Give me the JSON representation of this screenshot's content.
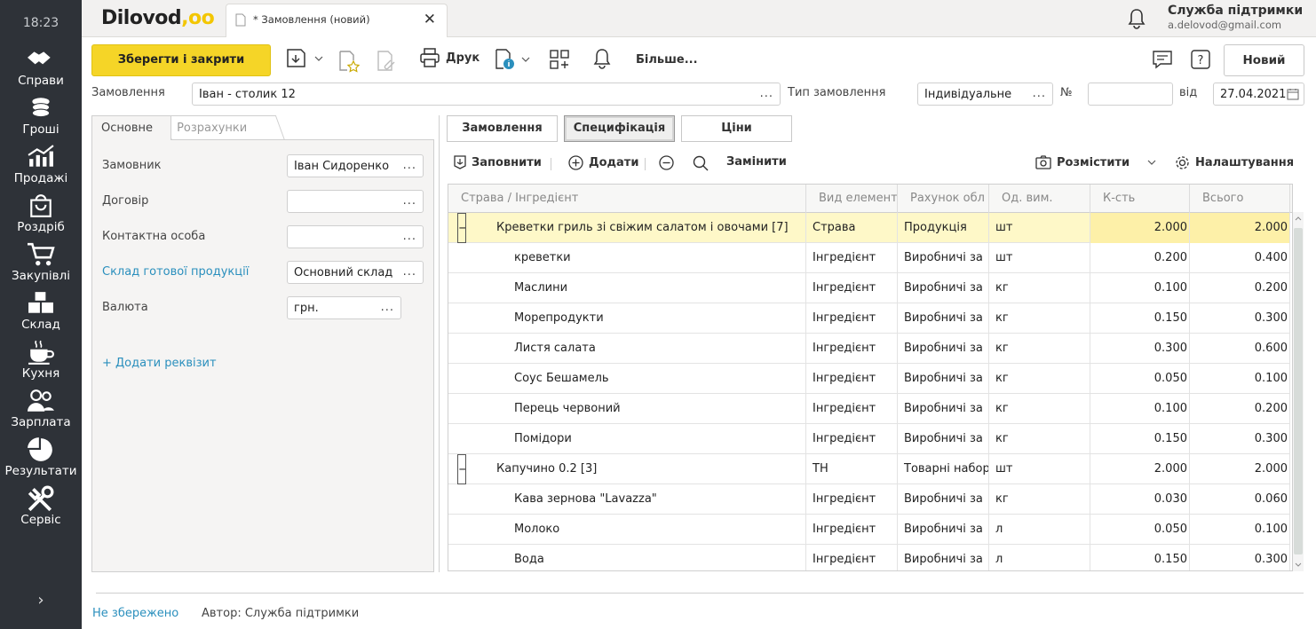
{
  "clock": "18:23",
  "sidebar": [
    {
      "label": "Справи",
      "icon": "handshake-icon"
    },
    {
      "label": "Гроші",
      "icon": "coins-icon"
    },
    {
      "label": "Продажі",
      "icon": "chart-icon"
    },
    {
      "label": "Роздріб",
      "icon": "shopping-bag-icon"
    },
    {
      "label": "Закупівлі",
      "icon": "cart-icon"
    },
    {
      "label": "Склад",
      "icon": "boxes-icon"
    },
    {
      "label": "Кухня",
      "icon": "cup-icon"
    },
    {
      "label": "Зарплата",
      "icon": "people-icon"
    },
    {
      "label": "Результати",
      "icon": "pie-icon"
    },
    {
      "label": "Сервіс",
      "icon": "tools-icon"
    }
  ],
  "sidebar_toggle": "›",
  "app": {
    "logo": "Dilovod",
    "logo_dots": ",oo",
    "tab_title": "* Замовлення (новий)",
    "tab_close": "✕"
  },
  "user": {
    "name": "Служба підтримки",
    "email": "a.delovod@gmail.com"
  },
  "toolbar": {
    "save_close": "Зберегти і закрити",
    "print": "Друк",
    "more": "Більше...",
    "new": "Новий"
  },
  "header": {
    "order_label": "Замовлення",
    "order_value": "Іван - столик 12",
    "type_label": "Тип замовлення",
    "type_value": "Індивідуальне",
    "num_label": "№",
    "num_value": "",
    "from_label": "від",
    "date_value": "27.04.2021",
    "dots": "..."
  },
  "left_tabs": [
    "Основне",
    "Розрахунки"
  ],
  "left_fields": [
    {
      "label": "Замовник",
      "value": "Іван Сидоренко"
    },
    {
      "label": "Договір",
      "value": ""
    },
    {
      "label": "Контактна особа",
      "value": ""
    },
    {
      "label": "Склад готової продукції",
      "value": "Основний склад"
    },
    {
      "label": "Валюта",
      "value": "грн."
    }
  ],
  "add_requisite": "+ Додати реквізит",
  "right_tabs": [
    "Замовлення",
    "Специфікація",
    "Ціни"
  ],
  "grid_toolbar": {
    "fill": "Заповнити",
    "add": "Додати",
    "replace": "Замінити",
    "place": "Розмістити",
    "settings": "Налаштування"
  },
  "columns": [
    "Страва / Інгредієнт",
    "Вид елемент",
    "Рахунок обл",
    "Од. вим.",
    "К-сть",
    "Всього"
  ],
  "rows": [
    {
      "name": "Креветки гриль зі свіжим салатом і овочами [7]",
      "kind": "Страва",
      "account": "Продукція",
      "unit": "шт",
      "qty": "2.000",
      "total": "2.000",
      "level": 0,
      "toggle": "−",
      "highlight": true
    },
    {
      "name": "креветки",
      "kind": "Інгредієнт",
      "account": "Виробничі за",
      "unit": "шт",
      "qty": "0.200",
      "total": "0.400",
      "level": 1
    },
    {
      "name": "Маслини",
      "kind": "Інгредієнт",
      "account": "Виробничі за",
      "unit": "кг",
      "qty": "0.100",
      "total": "0.200",
      "level": 1
    },
    {
      "name": "Морепродукти",
      "kind": "Інгредієнт",
      "account": "Виробничі за",
      "unit": "кг",
      "qty": "0.150",
      "total": "0.300",
      "level": 1
    },
    {
      "name": "Листя салата",
      "kind": "Інгредієнт",
      "account": "Виробничі за",
      "unit": "кг",
      "qty": "0.300",
      "total": "0.600",
      "level": 1
    },
    {
      "name": "Соус Бешамель",
      "kind": "Інгредієнт",
      "account": "Виробничі за",
      "unit": "кг",
      "qty": "0.050",
      "total": "0.100",
      "level": 1
    },
    {
      "name": "Перець червоний",
      "kind": "Інгредієнт",
      "account": "Виробничі за",
      "unit": "кг",
      "qty": "0.100",
      "total": "0.200",
      "level": 1
    },
    {
      "name": "Помідори",
      "kind": "Інгредієнт",
      "account": "Виробничі за",
      "unit": "кг",
      "qty": "0.150",
      "total": "0.300",
      "level": 1
    },
    {
      "name": "Капучино 0.2 [3]",
      "kind": "ТН",
      "account": "Товарні набор",
      "unit": "шт",
      "qty": "2.000",
      "total": "2.000",
      "level": 0,
      "toggle": "−"
    },
    {
      "name": "Кава зернова \"Lavazza\"",
      "kind": "Інгредієнт",
      "account": "Виробничі за",
      "unit": "кг",
      "qty": "0.030",
      "total": "0.060",
      "level": 1
    },
    {
      "name": "Молоко",
      "kind": "Інгредієнт",
      "account": "Виробничі за",
      "unit": "л",
      "qty": "0.050",
      "total": "0.100",
      "level": 1
    },
    {
      "name": "Вода",
      "kind": "Інгредієнт",
      "account": "Виробничі за",
      "unit": "л",
      "qty": "0.150",
      "total": "0.300",
      "level": 1
    }
  ],
  "footer": {
    "status": "Не збережено",
    "author": "Автор: Служба підтримки"
  }
}
